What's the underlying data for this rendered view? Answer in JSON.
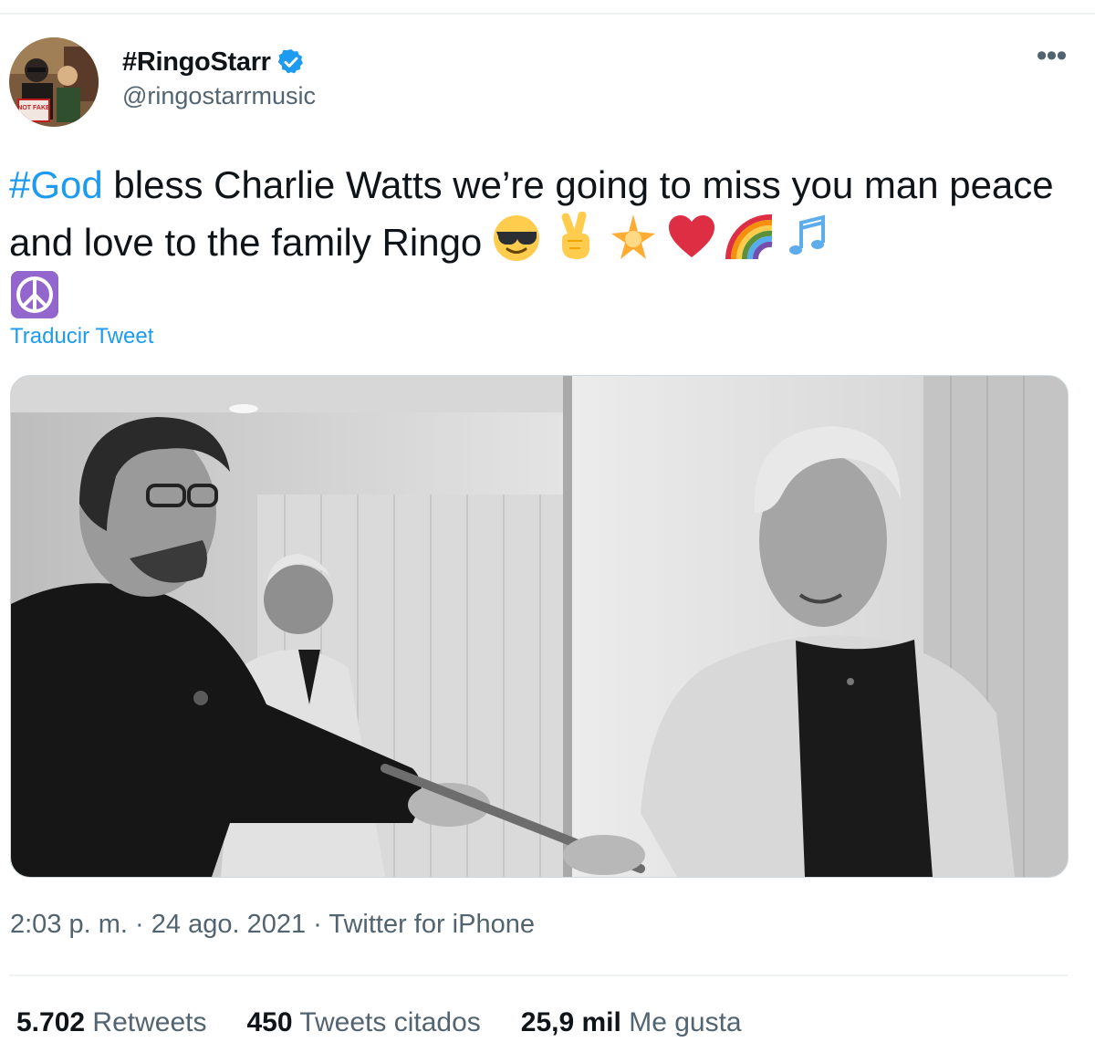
{
  "user": {
    "display_name": "#RingoStarr",
    "handle": "@ringostarrmusic",
    "verified_icon": "verified-badge-icon",
    "avatar_caption": "NOT FAKE"
  },
  "tweet": {
    "hashtag": "#God",
    "body": " bless Charlie Watts we’re going to miss you man peace and love to the family Ringo",
    "emojis": [
      "sunglasses-face-emoji",
      "victory-hand-emoji",
      "glowing-star-emoji",
      "red-heart-emoji",
      "rainbow-emoji",
      "musical-notes-emoji",
      "peace-symbol-emoji"
    ],
    "translate_label": "Traducir Tweet"
  },
  "meta": {
    "time": "2:03 p. m.",
    "date": "24 ago. 2021",
    "source": "Twitter for iPhone",
    "separator": " · "
  },
  "stats": {
    "retweets_count": "5.702",
    "retweets_label": "Retweets",
    "quotes_count": "450",
    "quotes_label": "Tweets citados",
    "likes_count": "25,9 mil",
    "likes_label": "Me gusta"
  },
  "colors": {
    "accent": "#1d9bf0",
    "text": "#0f1419",
    "secondary": "#536471"
  }
}
